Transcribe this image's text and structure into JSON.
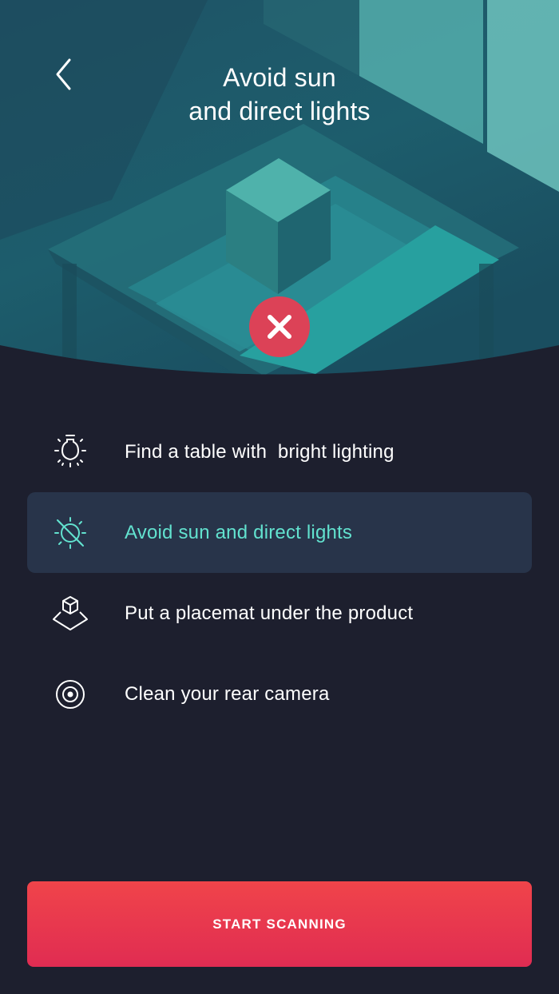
{
  "header": {
    "title_line1": "Avoid sun",
    "title_line2": "and direct lights",
    "back_icon": "chevron-left-icon"
  },
  "hero": {
    "status_icon": "close-icon",
    "status_color": "#dc4257"
  },
  "tips": [
    {
      "icon": "lightbulb-icon",
      "label": "Find a table with  bright lighting",
      "active": false
    },
    {
      "icon": "sun-off-icon",
      "label": "Avoid sun and direct lights",
      "active": true
    },
    {
      "icon": "cube-on-placemat-icon",
      "label": "Put a placemat under the product",
      "active": false
    },
    {
      "icon": "camera-lens-icon",
      "label": "Clean your rear camera",
      "active": false
    }
  ],
  "cta": {
    "label": "START SCANNING"
  },
  "colors": {
    "background": "#1d1f2e",
    "active_row": "#28344a",
    "active_text": "#62e2cf",
    "cta_gradient_top": "#f0444a",
    "cta_gradient_bottom": "#e02c52"
  }
}
